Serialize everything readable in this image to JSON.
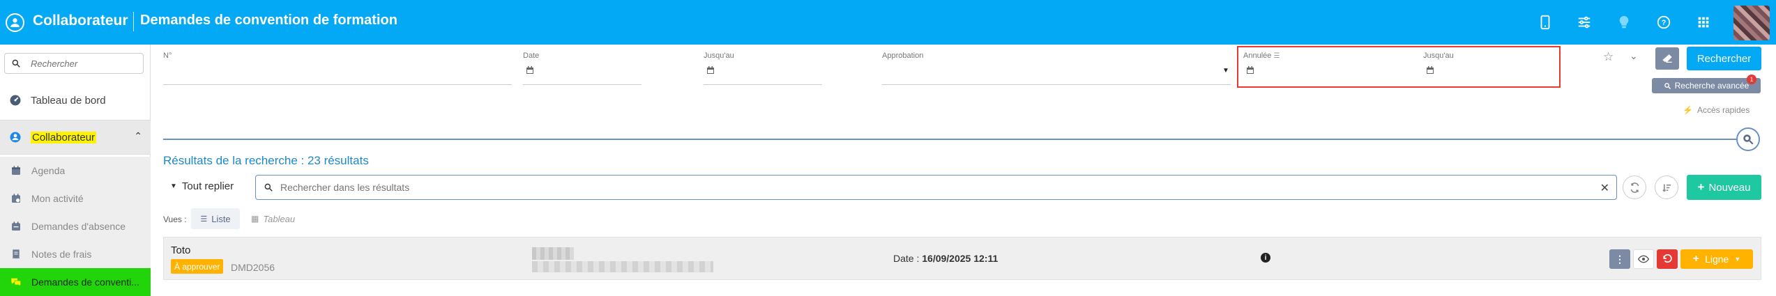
{
  "header": {
    "app_title": "Collaborateur",
    "page_title": "Demandes de convention de formation",
    "icons": [
      "mobile-icon",
      "sliders-icon",
      "lightbulb-icon",
      "help-icon",
      "apps-grid-icon"
    ]
  },
  "sidebar": {
    "search_placeholder": "Rechercher",
    "dashboard_label": "Tableau de bord",
    "section_label": "Collaborateur",
    "sub_items": [
      {
        "label": "Agenda",
        "icon": "calendar-icon"
      },
      {
        "label": "Mon activité",
        "icon": "activity-icon"
      },
      {
        "label": "Demandes d'absence",
        "icon": "absence-icon"
      },
      {
        "label": "Notes de frais",
        "icon": "receipt-icon"
      },
      {
        "label": "Demandes de conventi...",
        "icon": "chat-icon"
      }
    ]
  },
  "filters": {
    "num_label": "N°",
    "date_label": "Date",
    "jusquau_label": "Jusqu'au",
    "approbation_label": "Approbation",
    "annulee_label": "Annulée",
    "jusquau2_label": "Jusqu'au",
    "search_button": "Rechercher",
    "advanced_button": "Recherche avancée",
    "advanced_badge": "1",
    "quick_access": "Accès rapides"
  },
  "results": {
    "title": "Résultats de la recherche : 23 résultats",
    "fold_label": "Tout replier",
    "search_placeholder": "Rechercher dans les résultats",
    "new_button": "Nouveau",
    "views_label": "Vues :",
    "view_list": "Liste",
    "view_table": "Tableau"
  },
  "rows": [
    {
      "name": "Toto",
      "status": "À approuver",
      "ref": "DMD2056",
      "date_label": "Date : ",
      "date_value": "16/09/2025 12:11",
      "line_button": "Ligne"
    }
  ],
  "colors": {
    "primary": "#03a9f4",
    "success": "#1ec8a0",
    "warning": "#ffb300",
    "danger": "#e53935",
    "slate": "#7d8aa3",
    "highlight_yellow": "#fff200",
    "highlight_green": "#22d40a"
  }
}
